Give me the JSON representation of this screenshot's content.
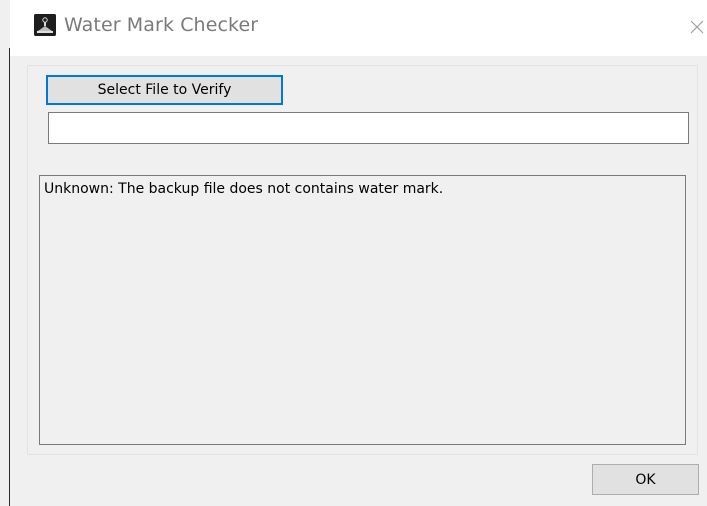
{
  "window": {
    "title": "Water Mark Checker",
    "app_icon": "watermark-app-icon",
    "close_icon": "close-icon"
  },
  "main": {
    "select_file_label": "Select File to Verify",
    "file_path_value": "",
    "result_text": "Unknown: The backup file does not contains water mark.",
    "ok_label": "OK"
  },
  "colors": {
    "accent": "#0078d7",
    "background": "#f0f0f0",
    "titlebar": "#ffffff",
    "button": "#e1e1e1"
  }
}
